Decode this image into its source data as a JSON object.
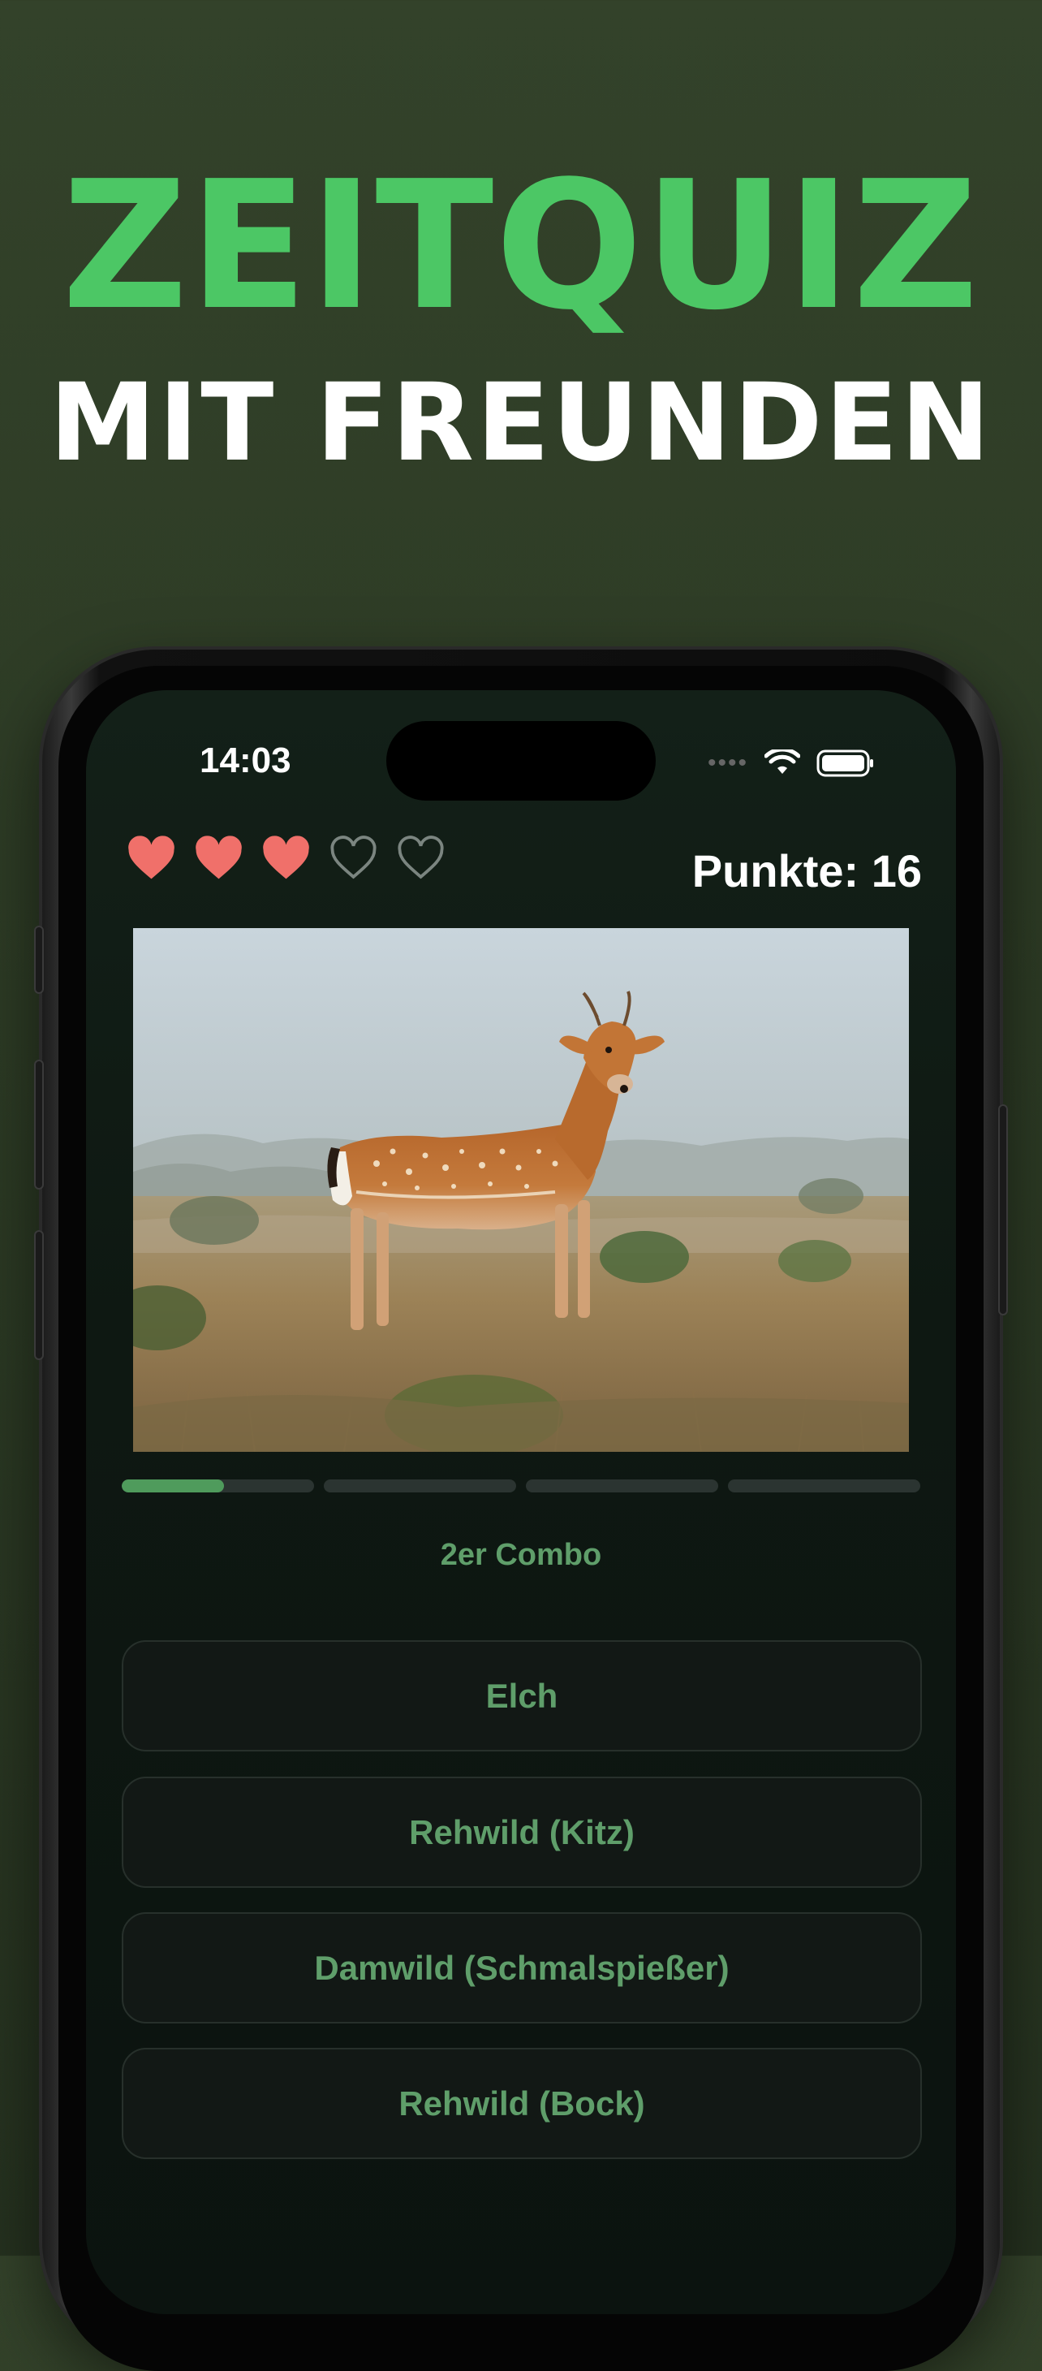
{
  "headline": {
    "line1": "ZEITQUIZ",
    "line2": "MIT FREUNDEN"
  },
  "colors": {
    "accent": "#4cc765",
    "background": "#2f3d27",
    "heart_full": "#f0706a",
    "answer_text": "#5f9e6a"
  },
  "status_bar": {
    "time": "14:03",
    "icons": [
      "cellular-signal-icon",
      "wifi-icon",
      "battery-icon"
    ]
  },
  "game": {
    "lives": {
      "filled": 3,
      "total": 5
    },
    "score_text": "Punkte: 16",
    "image_subject": "deer-photo",
    "progress": {
      "segments": 4,
      "current_fill_fraction": 0.53
    },
    "combo_text": "2er Combo",
    "answers": [
      "Elch",
      "Rehwild (Kitz)",
      "Damwild (Schmalspießer)",
      "Rehwild (Bock)"
    ]
  }
}
